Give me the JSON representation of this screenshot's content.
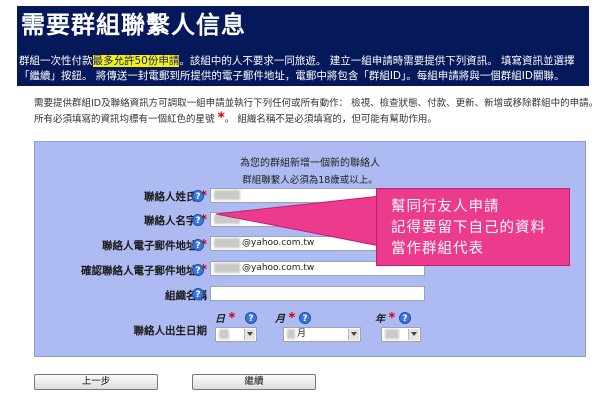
{
  "header": {
    "title": "需要群組聯繫人信息",
    "desc_line1_a": "群組一次性付款",
    "desc_line1_highlight": "最多允許50份申請",
    "desc_line1_b": "。該組中的人不要求一同旅遊。 建立一組申請時需要提供下列資訊。 填寫資訊並選擇",
    "desc_line2": "「繼續」按鈕。 將傳送一封電郵到所提供的電子郵件地址，電郵中將包含「群組ID」。每組申請將與一個群組ID關聯。"
  },
  "intro": {
    "line1": "需要提供群組ID及聯絡資訊方可調取一組申請並執行下列任何或所有動作： 檢視、檢查狀態、付款、更新、新增或移除群組中的申請。",
    "line2_a": "所有必須填寫的資訊均標有一個紅色的星號",
    "star": "*",
    "line2_b": "。 組織名稱不是必須填寫的，但可能有幫助作用。"
  },
  "form": {
    "title": "為您的群組新增一個新的聯絡人",
    "subtitle": "群組聯繫人必須為18歲或以上。",
    "fields": [
      {
        "label": "聯絡人姓氏",
        "required": "*",
        "value": ""
      },
      {
        "label": "聯絡人名字",
        "required": "*",
        "value": ""
      },
      {
        "label": "聯絡人電子郵件地址",
        "required": "*",
        "value": "@yahoo.com.tw"
      },
      {
        "label": "確認聯絡人電子郵件地址",
        "required": "*",
        "value": "@yahoo.com.tw"
      },
      {
        "label": "組織名稱",
        "required": "",
        "value": ""
      }
    ],
    "dob": {
      "label": "聯絡人出生日期",
      "day_label": "日",
      "month_label": "月",
      "year_label": "年",
      "month_value": "月",
      "required": "*"
    },
    "help_glyph": "?"
  },
  "callout": {
    "line1": "幫同行友人申請",
    "line2": "記得要留下自己的資料",
    "line3": "當作群組代表",
    "color": "#ec3a8c"
  },
  "buttons": {
    "back": "上一步",
    "continue": "繼續"
  },
  "colors": {
    "header_bg": "#05185a",
    "panel_bg": "#aebbf2",
    "required": "#d40000",
    "highlight": "#f2f20a"
  }
}
